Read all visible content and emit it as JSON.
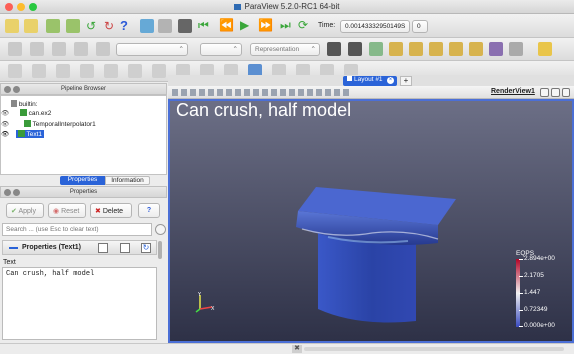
{
  "window": {
    "title": "ParaView 5.2.0-RC1 64-bit"
  },
  "toolbar": {
    "time_label": "Time:",
    "time_value": "0.00143332950149S",
    "time_index": "0",
    "representation": "Representation"
  },
  "pipeline_browser": {
    "title": "Pipeline Browser",
    "items": [
      {
        "label": "builtin:"
      },
      {
        "label": "can.ex2"
      },
      {
        "label": "TemporalInterpolator1"
      },
      {
        "label": "Text1"
      }
    ]
  },
  "properties_panel": {
    "tabs": [
      {
        "label": "Properties"
      },
      {
        "label": "Information"
      }
    ],
    "title": "Properties",
    "apply_label": "Apply",
    "reset_label": "Reset",
    "delete_label": "Delete",
    "help_label": "?",
    "search_placeholder": "Search ... (use Esc to clear text)",
    "section_label": "Properties (Text1)",
    "text_field_label": "Text",
    "text_value": "Can crush, half model"
  },
  "layout": {
    "tab_label": "Layout #1",
    "render_view_label": "RenderView1",
    "overlay_text": "Can crush, half model"
  },
  "color_legend": {
    "title": "EQPS",
    "labels": [
      "2.894e+00",
      "2.1705",
      "1.447",
      "0.72349",
      "0.000e+00"
    ],
    "top_color": "#b40426",
    "bottom_color": "#3b4cc0"
  },
  "colors": {
    "viewport_top": "#6c6f86",
    "viewport_bottom": "#2e3147",
    "selected_tab": "#2a63d8",
    "pipeline_green": "#3a9b3a"
  },
  "icons": [
    "open-icon",
    "save-icon",
    "undo-icon",
    "redo-icon",
    "help-icon",
    "play-icon",
    "first-frame-icon",
    "last-frame-icon",
    "eye-icon",
    "gear-icon",
    "close-icon",
    "axes-icon"
  ]
}
